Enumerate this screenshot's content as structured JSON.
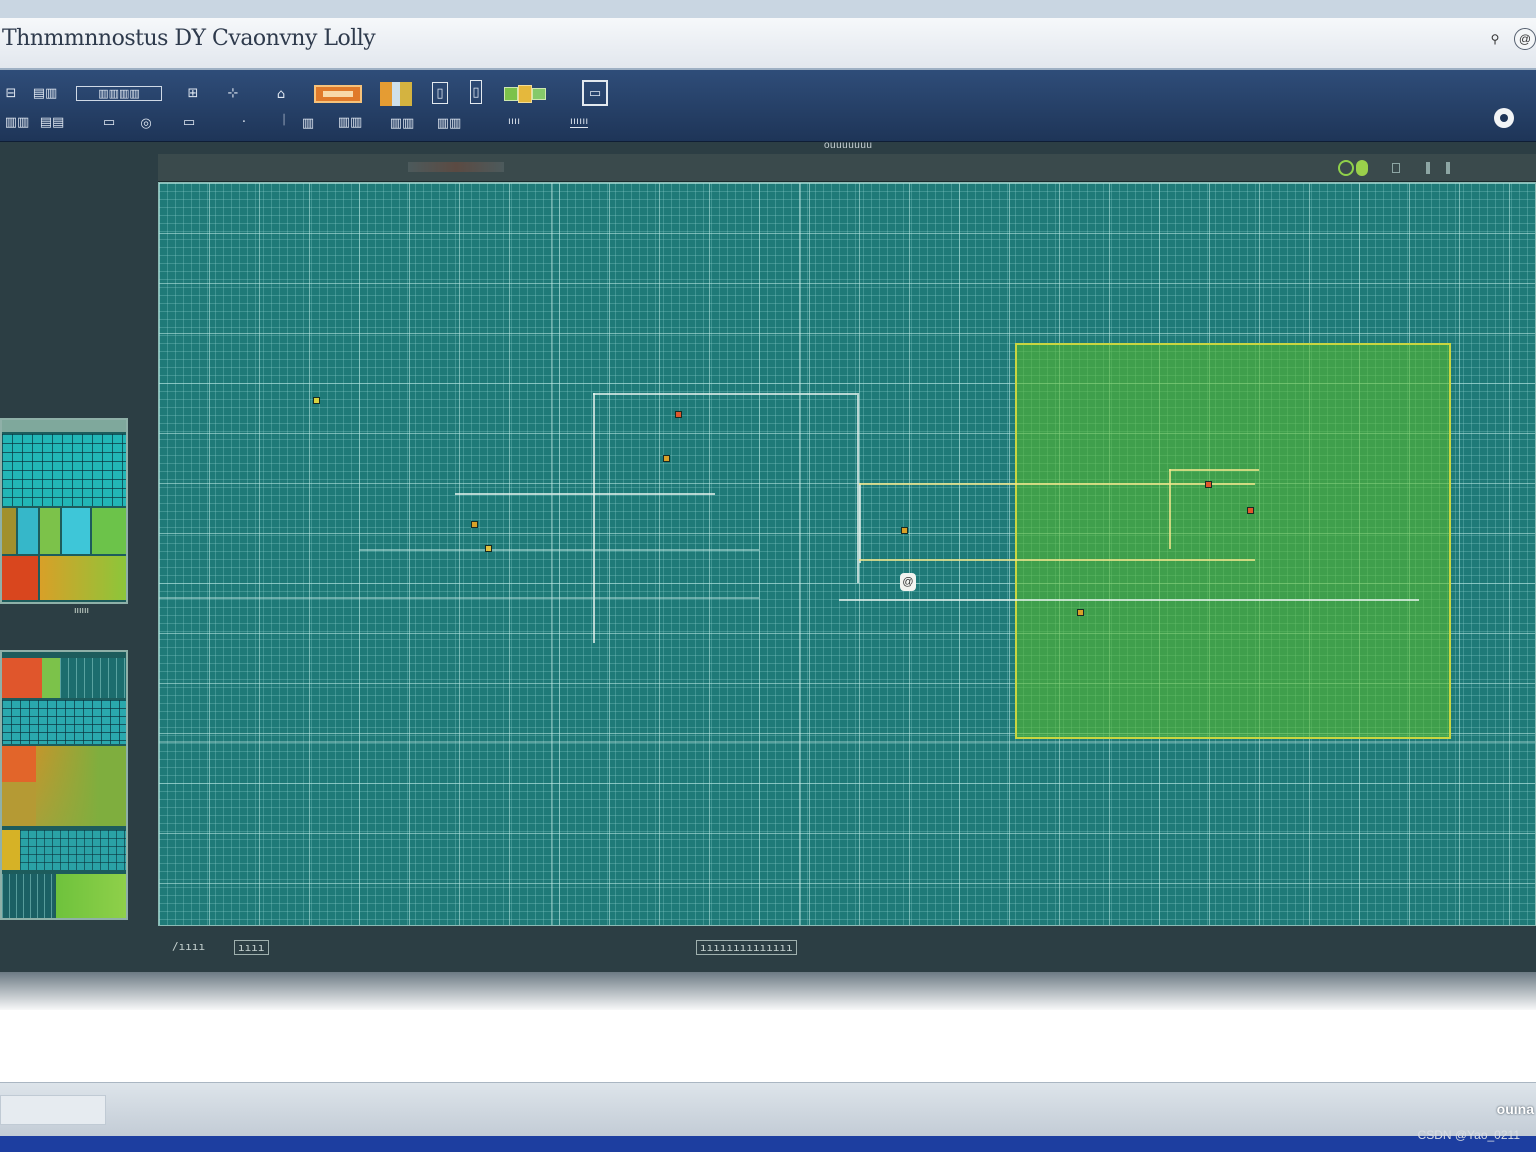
{
  "window": {
    "title": "Thnmmnnostus DY Cvaonvny Lolly",
    "buttons": [
      {
        "name": "pin",
        "icon": "pin-icon",
        "glyph": "⚲"
      },
      {
        "name": "help",
        "icon": "help-circle-icon",
        "glyph": "@"
      }
    ]
  },
  "toolbar": {
    "tools": [
      {
        "id": "t1",
        "icon": "frame-icon",
        "glyph": "⊟"
      },
      {
        "id": "t2",
        "icon": "layers-icon",
        "glyph": "▤▥"
      },
      {
        "id": "t3",
        "icon": "ruler-icon",
        "glyph": "▥▥▥▥"
      },
      {
        "id": "t4",
        "icon": "chip-icon",
        "glyph": "⊞"
      },
      {
        "id": "t5",
        "icon": "cursor-icon",
        "glyph": "⊹"
      },
      {
        "id": "t6",
        "icon": "lock-icon",
        "glyph": "⌂"
      },
      {
        "id": "t7",
        "icon": "highlight-bar-icon",
        "glyph": ""
      },
      {
        "id": "t8",
        "icon": "color-swatch-icon",
        "glyph": ""
      },
      {
        "id": "t9",
        "icon": "panel-icon",
        "glyph": "▯"
      },
      {
        "id": "t10",
        "icon": "column-icon",
        "glyph": "▯"
      },
      {
        "id": "t11",
        "icon": "map-layer-icon",
        "glyph": ""
      },
      {
        "id": "t12",
        "icon": "monitor-icon",
        "glyph": "▭"
      }
    ],
    "second_row": [
      {
        "id": "r1",
        "icon": "grid-icon",
        "glyph": "▥▥"
      },
      {
        "id": "r2",
        "icon": "table-icon",
        "glyph": "▤▤"
      },
      {
        "id": "r3",
        "icon": "window-icon",
        "glyph": "▭"
      },
      {
        "id": "r4",
        "icon": "target-icon",
        "glyph": "◎"
      },
      {
        "id": "r5",
        "icon": "box-icon",
        "glyph": "▭"
      },
      {
        "id": "r6",
        "icon": "dot-icon",
        "glyph": "·"
      },
      {
        "id": "r7",
        "icon": "bar-icon",
        "glyph": "ᛁ"
      },
      {
        "id": "r8",
        "icon": "chart-icon",
        "glyph": "▥"
      },
      {
        "id": "r9",
        "icon": "grid-small-icon",
        "glyph": "▥▥"
      },
      {
        "id": "r10",
        "icon": "layout-icon",
        "glyph": "▥▥"
      },
      {
        "id": "r11",
        "icon": "columns-icon",
        "glyph": "▥▥"
      }
    ],
    "labels": {
      "layer": "ıııı",
      "view": "ıııı",
      "monitor": "ıııııı"
    },
    "right_icon": "record-icon"
  },
  "workspace": {
    "caption": "ouuuuuuu",
    "canvas_header_icons": [
      "green-status-icon",
      "settings-icon",
      "handle-icon"
    ]
  },
  "sidebar": {
    "panel_1": {
      "label": "ıııııı"
    },
    "panel_2": {
      "label": ""
    }
  },
  "canvas": {
    "highlight_color": "#5abe28",
    "grid_color": "#1f7a78",
    "cursor_glyph": "@"
  },
  "canvas_footer": {
    "left_a": "/ıııı",
    "left_b": "ıııı",
    "center": "ıııııııııııııı"
  },
  "status": {
    "right_text": "ouına"
  },
  "watermark": "CSDN @Yao_0211"
}
